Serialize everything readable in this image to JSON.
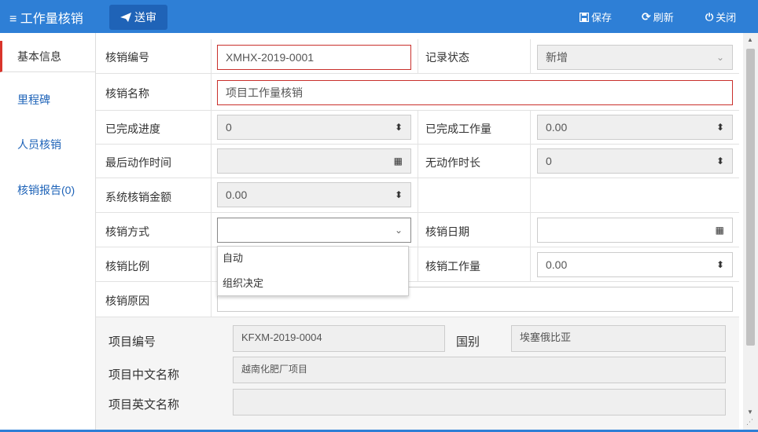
{
  "topbar": {
    "title": "工作量核销",
    "send_label": "送审",
    "save_label": "保存",
    "refresh_label": "刷新",
    "close_label": "关闭"
  },
  "sidebar": {
    "items": [
      {
        "label": "基本信息"
      },
      {
        "label": "里程碑"
      },
      {
        "label": "人员核销"
      },
      {
        "label": "核销报告(0)"
      }
    ]
  },
  "form": {
    "code_label": "核销编号",
    "code_value": "XMHX-2019-0001",
    "status_label": "记录状态",
    "status_value": "新增",
    "name_label": "核销名称",
    "name_value": "项目工作量核销",
    "progress_label": "已完成进度",
    "progress_value": "0",
    "done_label": "已完成工作量",
    "done_value": "0.00",
    "last_time_label": "最后动作时间",
    "idle_label": "无动作时长",
    "idle_value": "0",
    "amount_label": "系统核销金额",
    "amount_value": "0.00",
    "method_label": "核销方式",
    "method_value": "",
    "method_options": [
      "自动",
      "组织决定"
    ],
    "date_label": "核销日期",
    "ratio_label": "核销比例",
    "workload_label": "核销工作量",
    "workload_value": "0.00",
    "reason_label": "核销原因"
  },
  "project": {
    "code_label": "项目编号",
    "code_value": "KFXM-2019-0004",
    "country_label": "国别",
    "country_value": "埃塞俄比亚",
    "cn_name_label": "项目中文名称",
    "cn_name_value": "越南化肥厂项目",
    "en_name_label": "项目英文名称",
    "en_name_value": ""
  },
  "colors": {
    "topbar": "#2e7fd6",
    "send_button": "#1f63b7",
    "error_border": "#c9302c",
    "active_marker": "#d9342b",
    "link": "#1e63b8"
  }
}
